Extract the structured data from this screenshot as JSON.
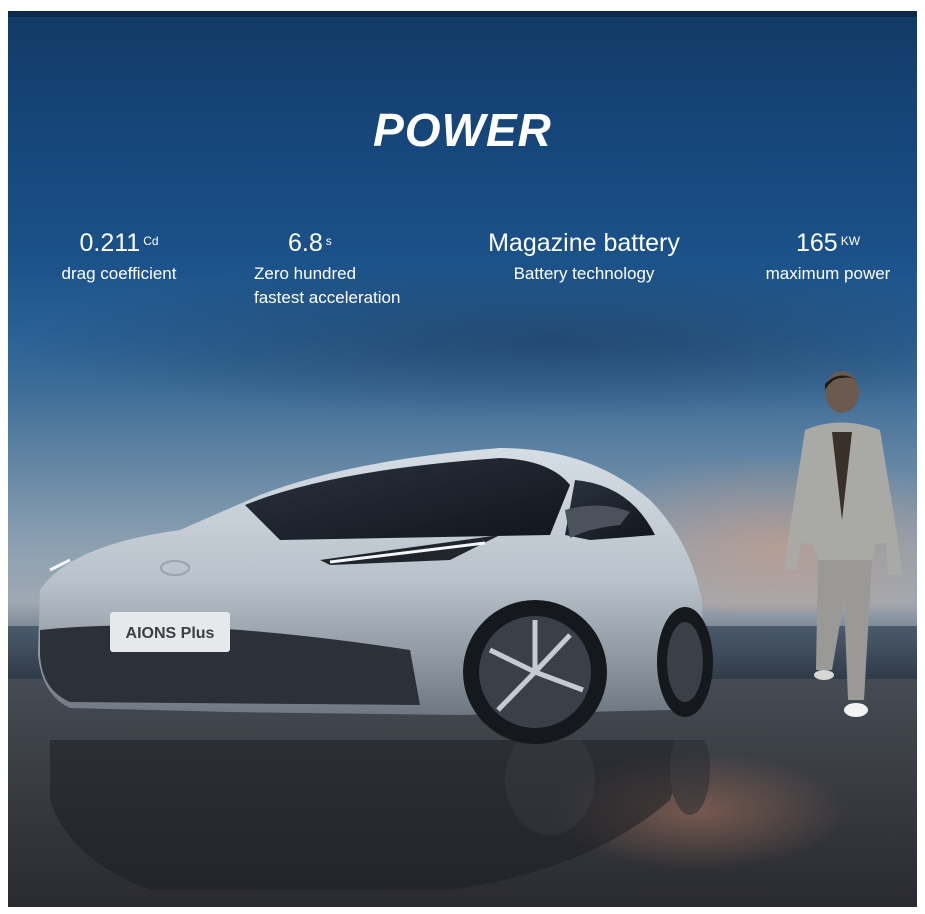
{
  "title": "POWER",
  "stats": [
    {
      "value": "0.211",
      "unit": "Cd",
      "description": "drag coefficient"
    },
    {
      "value": "6.8",
      "unit": "s",
      "description_lines": [
        "Zero hundred",
        "fastest acceleration"
      ]
    },
    {
      "value": "Magazine battery",
      "unit": "",
      "description": "Battery technology"
    },
    {
      "value": "165",
      "unit": "KW",
      "description": "maximum power"
    }
  ],
  "car": {
    "plate_text": "AIONS Plus"
  },
  "colors": {
    "sky_top": "#133a66",
    "text": "#ffffff",
    "sunset_glow": "#d69b7d"
  }
}
